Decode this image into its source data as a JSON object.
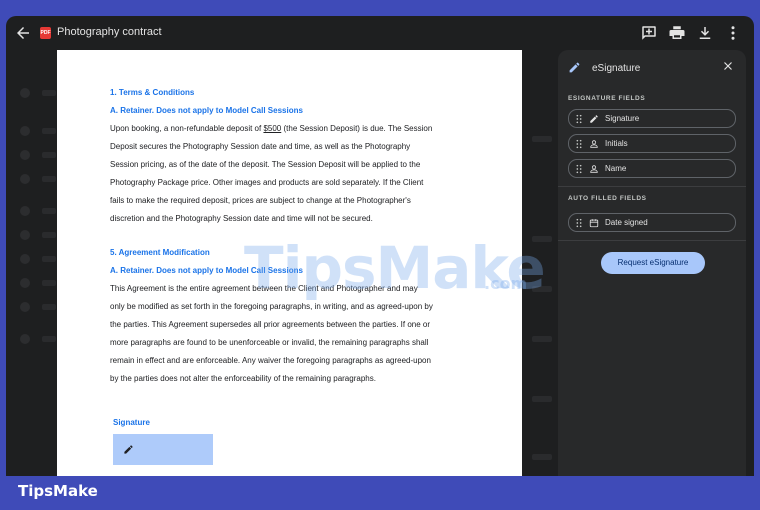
{
  "window": {
    "title": "Photography contract",
    "file_type": "PDF"
  },
  "document": {
    "sections": [
      {
        "heading": "1. Terms & Conditions",
        "subheading": "A. Retainer.  Does not apply to Model Call Sessions",
        "lines": [
          "(the Session Deposit) is due. The Session",
          "Deposit secures the Photography Session date and time, as well as the Photography",
          "Session pricing, as of the date of the deposit. The Session Deposit will be applied to the",
          "Photography Package price. Other images and products are sold separately. If the Client",
          "fails to make the required deposit, prices are subject to change at the Photographer's",
          "discretion and the Photography Session date and time will not be secured."
        ],
        "first_line_prefix": "Upon booking, a non-refundable deposit of ",
        "deposit_amount": "$500"
      },
      {
        "heading": "5. Agreement Modification",
        "subheading": "A. Retainer.  Does not apply to Model Call Sessions",
        "lines": [
          "This Agreement is the entire agreement between the Client and Photographer and may",
          "only be modified as set forth in the foregoing paragraphs, in writing, and as agreed-upon by",
          "the parties.  This Agreement supersedes all prior agreements between the parties. If one or",
          "more paragraphs are found to be unenforceable or invalid, the remaining paragraphs shall",
          "remain in effect and are enforceable. Any waiver the foregoing paragraphs as agreed-upon",
          "by the parties does not alter the enforceability of the remaining paragraphs."
        ]
      }
    ],
    "signature_label": "Signature"
  },
  "watermark": {
    "main": "TipsMake",
    "suffix": ".com"
  },
  "esignature": {
    "title": "eSignature",
    "signature_fields_heading": "ESIGNATURE FIELDS",
    "signature_fields": [
      {
        "label": "Signature",
        "icon": "pen-icon"
      },
      {
        "label": "Initials",
        "icon": "person-icon"
      },
      {
        "label": "Name",
        "icon": "person-icon"
      }
    ],
    "auto_fields_heading": "AUTO FILLED FIELDS",
    "auto_fields": [
      {
        "label": "Date signed",
        "icon": "calendar-icon"
      }
    ],
    "request_button": "Request eSignature"
  },
  "brand": "TipsMake",
  "colors": {
    "accent_blue": "#1a73e8",
    "panel_bg": "#28292a",
    "page_bg": "#ffffff",
    "frame_bg": "#3f4bb8",
    "request_button": "#a8c7fa"
  }
}
